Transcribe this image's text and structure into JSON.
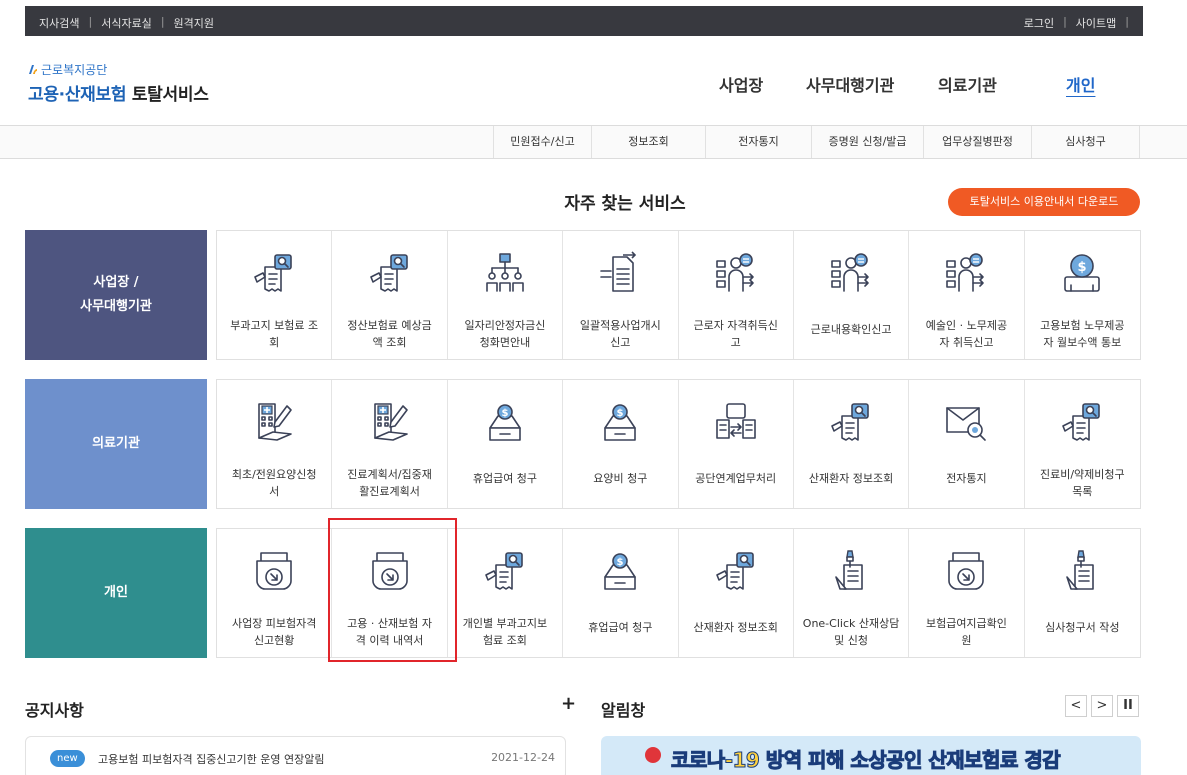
{
  "topbar": {
    "left": [
      "지사검색",
      "서식자료실",
      "원격지원"
    ],
    "right": [
      "로그인",
      "사이트맵"
    ],
    "separator": "|"
  },
  "brand": {
    "org": "근로복지공단",
    "title_blue": "고용·산재보험",
    "title_black": "토탈서비스"
  },
  "main_nav": [
    "사업장",
    "사무대행기관",
    "의료기관",
    "개인"
  ],
  "sub_nav": [
    "민원접수/신고",
    "정보조회",
    "전자통지",
    "증명원 신청/발급",
    "업무상질병판정",
    "심사청구"
  ],
  "services": {
    "title": "자주 찾는 서비스",
    "download_button": "토탈서비스 이용안내서 다운로드",
    "categories": [
      {
        "label_line1": "사업장 /",
        "label_line2": "사무대행기관",
        "tiles": [
          {
            "l1": "부과고지 보험료 조",
            "l2": "회",
            "icon": "bill-search-icon"
          },
          {
            "l1": "정산보험료 예상금",
            "l2": "액 조회",
            "icon": "bill-search-icon"
          },
          {
            "l1": "일자리안정자금신",
            "l2": "청화면안내",
            "icon": "org-chart-icon"
          },
          {
            "l1": "일괄적용사업개시",
            "l2": "신고",
            "icon": "document-arrow-icon"
          },
          {
            "l1": "근로자 자격취득신",
            "l2": "고",
            "icon": "worker-list-icon"
          },
          {
            "l1": "근로내용확인신고",
            "l2": "",
            "icon": "worker-list-icon"
          },
          {
            "l1": "예술인 · 노무제공",
            "l2": "자 취득신고",
            "icon": "worker-list-icon"
          },
          {
            "l1": "고용보험 노무제공",
            "l2": "자 월보수액 통보",
            "icon": "money-bag-icon"
          }
        ]
      },
      {
        "label_line1": "의료기관",
        "label_line2": "",
        "tiles": [
          {
            "l1": "최초/전원요양신청",
            "l2": "서",
            "icon": "hospital-pen-icon"
          },
          {
            "l1": "진료계획서/집중재",
            "l2": "활진료계획서",
            "icon": "hospital-pen-icon"
          },
          {
            "l1": "휴업급여 청구",
            "l2": "",
            "icon": "coin-box-icon"
          },
          {
            "l1": "요양비 청구",
            "l2": "",
            "icon": "coin-box-icon"
          },
          {
            "l1": "공단연계업무처리",
            "l2": "",
            "icon": "document-exchange-icon"
          },
          {
            "l1": "산재환자 정보조회",
            "l2": "",
            "icon": "bill-search-icon"
          },
          {
            "l1": "전자통지",
            "l2": "",
            "icon": "mail-search-icon"
          },
          {
            "l1": "진료비/약제비청구",
            "l2": "목록",
            "icon": "bill-search-icon"
          }
        ]
      },
      {
        "label_line1": "개인",
        "label_line2": "",
        "tiles": [
          {
            "l1": "사업장 피보험자격",
            "l2": "신고현황",
            "icon": "folder-download-icon"
          },
          {
            "l1": "고용 · 산재보험 자",
            "l2": "격 이력 내역서",
            "icon": "folder-download-icon"
          },
          {
            "l1": "개인별 부과고지보",
            "l2": "험료 조회",
            "icon": "bill-search-icon"
          },
          {
            "l1": "휴업급여 청구",
            "l2": "",
            "icon": "coin-box-icon"
          },
          {
            "l1": "산재환자 정보조회",
            "l2": "",
            "icon": "bill-search-icon"
          },
          {
            "l1": "One-Click 산재상담",
            "l2": "및 신청",
            "icon": "pen-document-icon"
          },
          {
            "l1": "보험급여지급확인",
            "l2": "원",
            "icon": "folder-download-icon"
          },
          {
            "l1": "심사청구서 작성",
            "l2": "",
            "icon": "pen-document-icon"
          }
        ]
      }
    ]
  },
  "notice": {
    "title": "공지사항",
    "more": "+",
    "items": [
      {
        "badge": "new",
        "text": "고용보험 피보험자격 집중신고기한 운영 연장알림",
        "date": "2021-12-24"
      }
    ]
  },
  "alarm": {
    "title": "알림창",
    "controls": [
      "<",
      ">",
      "II"
    ],
    "banner_text": "코로나-19 방역 피해 소상공인 산재보험료 경감"
  },
  "colors": {
    "topbar": "#38393f",
    "accent_blue": "#1e63b5",
    "download_orange": "#f05a24",
    "cat_business": "#4e5580",
    "cat_medical": "#6e90cc",
    "cat_personal": "#2f8e8e",
    "highlight_red": "#e1252b"
  }
}
